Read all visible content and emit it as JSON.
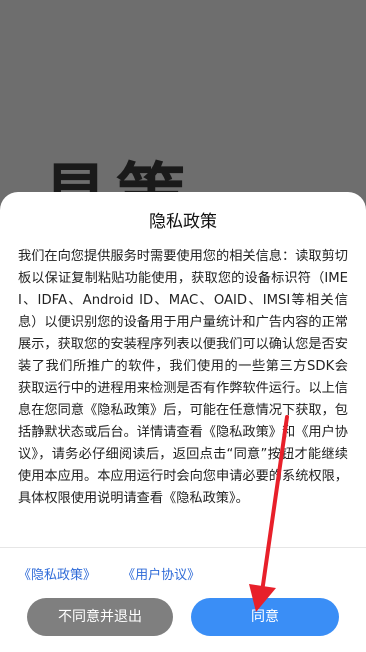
{
  "background": {
    "art_text": "具策"
  },
  "dialog": {
    "title": "隐私政策",
    "body": "我们在向您提供服务时需要使用您的相关信息：读取剪切板以保证复制粘贴功能使用，获取您的设备标识符（IMEI、IDFA、Android ID、MAC、OAID、IMSI等相关信息）以便识别您的设备用于用户量统计和广告内容的正常展示，获取您的安装程序列表以便我们可以确认您是否安装了我们所推广的软件，我们使用的一些第三方SDK会获取运行中的进程用来检测是否有作弊软件运行。以上信息在您同意《隐私政策》后，可能在任意情况下获取，包括静默状态或后台。详情请查看《隐私政策》和《用户协议》，请务必仔细阅读后，返回点击“同意”按钮才能继续使用本应用。本应用运行时会向您申请必要的系统权限，具体权限使用说明请查看《隐私政策》。",
    "links": {
      "privacy": "《隐私政策》",
      "agreement": "《用户协议》"
    },
    "buttons": {
      "decline": "不同意并退出",
      "agree": "同意"
    }
  },
  "colors": {
    "accent": "#3a8ef6",
    "link": "#2f6bd8",
    "decline": "#7f7f7f",
    "annotation_arrow": "#e8202a"
  }
}
